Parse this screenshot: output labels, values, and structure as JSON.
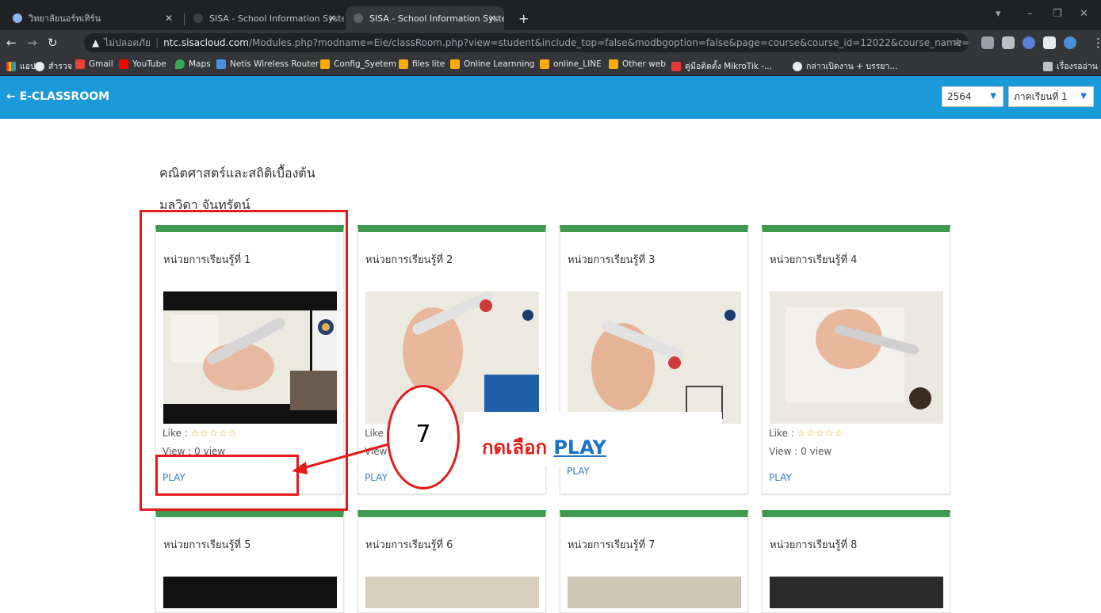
{
  "browser": {
    "tabs": [
      {
        "title": "วิทยาลัยนอร์ทเทิร์น"
      },
      {
        "title": "SISA - School Information Syste"
      },
      {
        "title": "SISA - School Information Syste"
      }
    ],
    "new_tab": "+",
    "insecure_label": "ไม่ปลอดภัย",
    "url_host": "ntc.sisacloud.com",
    "url_path": "/Modules.php?modname=Eie/classRoom.php?view=student&include_top=false&modbgoption=false&page=course&course_id=12022&course_name=คณิตศาสตร์และ...",
    "bookmarks": [
      {
        "label": "แอป"
      },
      {
        "label": "สำรวจ"
      },
      {
        "label": "Gmail"
      },
      {
        "label": "YouTube"
      },
      {
        "label": "Maps"
      },
      {
        "label": "Netis Wireless Router"
      },
      {
        "label": "Config_Syetem"
      },
      {
        "label": "files lite"
      },
      {
        "label": "Online Learnning"
      },
      {
        "label": "online_LINE"
      },
      {
        "label": "Other web"
      },
      {
        "label": "คู่มือติดตั้ง MikroTik -..."
      },
      {
        "label": "กล่าวเปิดงาน + บรรยา..."
      },
      {
        "label": "เรื่องรออ่าน"
      }
    ]
  },
  "app": {
    "title": "E-CLASSROOM",
    "year": "2564",
    "semester": "ภาคเรียนที่ 1"
  },
  "course": {
    "name": "คณิตศาสตร์และสถิติเบื้องต้น",
    "teacher": "มลวิดา จันทรัตน์"
  },
  "card_labels": {
    "like": "Like :",
    "stars": "☆☆☆☆☆",
    "view": "View : 0 view",
    "play": "PLAY"
  },
  "cards": [
    {
      "unit": "หน่วยการเรียนรู้ที่ 1"
    },
    {
      "unit": "หน่วยการเรียนรู้ที่ 2"
    },
    {
      "unit": "หน่วยการเรียนรู้ที่ 3"
    },
    {
      "unit": "หน่วยการเรียนรู้ที่ 4"
    },
    {
      "unit": "หน่วยการเรียนรู้ที่ 5"
    },
    {
      "unit": "หน่วยการเรียนรู้ที่ 6"
    },
    {
      "unit": "หน่วยการเรียนรู้ที่ 7"
    },
    {
      "unit": "หน่วยการเรียนรู้ที่ 8"
    }
  ],
  "annotation": {
    "step": "7",
    "instruction": "กดเลือก",
    "instruction_link": "PLAY",
    "color": "#e31b1b"
  },
  "colors": {
    "header": "#1a9ad8",
    "card_top": "#3f9a4f",
    "play_link": "#3a7ec2",
    "stars": "#f0a500"
  }
}
